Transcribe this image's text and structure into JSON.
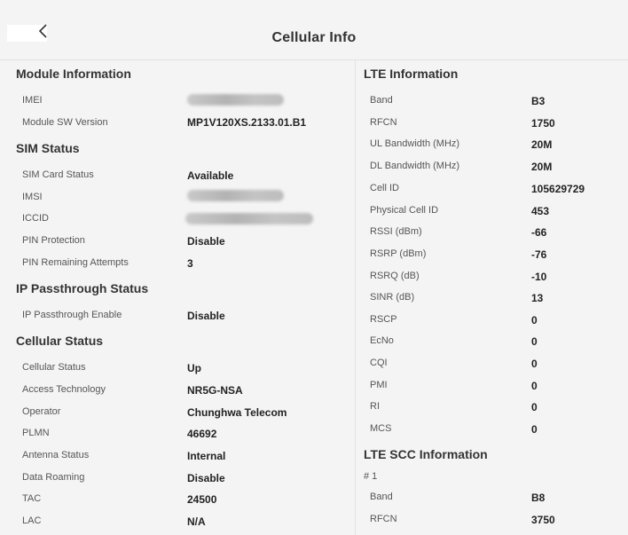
{
  "header": {
    "title": "Cellular Info"
  },
  "left": {
    "module": {
      "title": "Module Information",
      "rows": [
        {
          "label": "IMEI",
          "value": ""
        },
        {
          "label": "Module SW Version",
          "value": "MP1V120XS.2133.01.B1"
        }
      ]
    },
    "sim": {
      "title": "SIM Status",
      "rows": [
        {
          "label": "SIM Card Status",
          "value": "Available"
        },
        {
          "label": "IMSI",
          "value": ""
        },
        {
          "label": "ICCID",
          "value": ""
        },
        {
          "label": "PIN Protection",
          "value": "Disable"
        },
        {
          "label": "PIN Remaining Attempts",
          "value": "3"
        }
      ]
    },
    "ip": {
      "title": "IP Passthrough Status",
      "rows": [
        {
          "label": "IP Passthrough Enable",
          "value": "Disable"
        }
      ]
    },
    "cellular": {
      "title": "Cellular Status",
      "rows": [
        {
          "label": "Cellular Status",
          "value": "Up"
        },
        {
          "label": "Access Technology",
          "value": "NR5G-NSA"
        },
        {
          "label": "Operator",
          "value": "Chunghwa Telecom"
        },
        {
          "label": "PLMN",
          "value": "46692"
        },
        {
          "label": "Antenna Status",
          "value": "Internal"
        },
        {
          "label": "Data Roaming",
          "value": "Disable"
        },
        {
          "label": "TAC",
          "value": "24500"
        },
        {
          "label": "LAC",
          "value": "N/A"
        }
      ]
    }
  },
  "right": {
    "lte": {
      "title": "LTE Information",
      "rows": [
        {
          "label": "Band",
          "value": "B3"
        },
        {
          "label": "RFCN",
          "value": "1750"
        },
        {
          "label": "UL Bandwidth (MHz)",
          "value": "20M"
        },
        {
          "label": "DL Bandwidth (MHz)",
          "value": "20M"
        },
        {
          "label": "Cell ID",
          "value": "105629729"
        },
        {
          "label": "Physical Cell ID",
          "value": "453"
        },
        {
          "label": "RSSI (dBm)",
          "value": "-66"
        },
        {
          "label": "RSRP (dBm)",
          "value": "-76"
        },
        {
          "label": "RSRQ (dB)",
          "value": "-10"
        },
        {
          "label": "SINR (dB)",
          "value": "13"
        },
        {
          "label": "RSCP",
          "value": "0"
        },
        {
          "label": "EcNo",
          "value": "0"
        },
        {
          "label": "CQI",
          "value": "0"
        },
        {
          "label": "PMI",
          "value": "0"
        },
        {
          "label": "RI",
          "value": "0"
        },
        {
          "label": "MCS",
          "value": "0"
        }
      ]
    },
    "scc": {
      "title": "LTE SCC Information",
      "index": "# 1",
      "rows": [
        {
          "label": "Band",
          "value": "B8"
        },
        {
          "label": "RFCN",
          "value": "3750"
        }
      ]
    }
  }
}
